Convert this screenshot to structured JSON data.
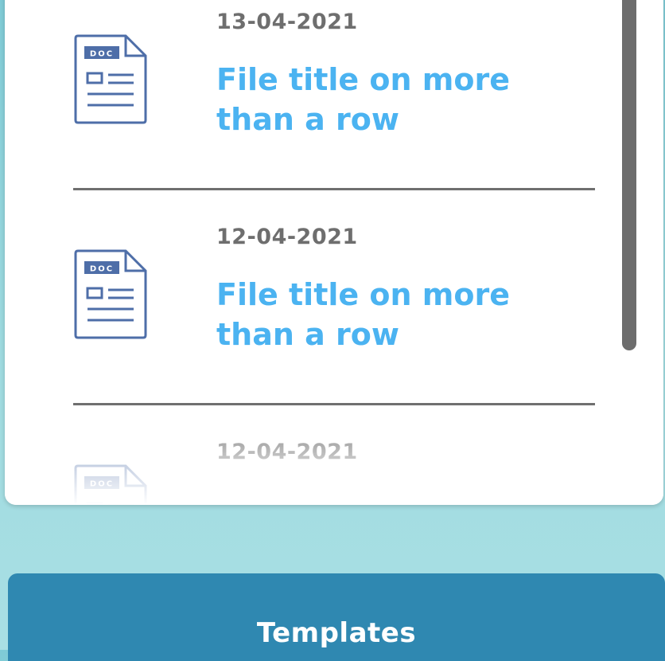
{
  "colors": {
    "title_accent": "#4bb3f1",
    "date_text": "#6e6e6e",
    "icon_stroke": "#4e6ea8",
    "button_bg": "#2f88b1",
    "button_text": "#ffffff"
  },
  "file_list": {
    "items": [
      {
        "icon": "doc-icon",
        "icon_label": "DOC",
        "date": "13-04-2021",
        "title": "File title on more than a row"
      },
      {
        "icon": "doc-icon",
        "icon_label": "DOC",
        "date": "12-04-2021",
        "title": "File title on more than a row"
      },
      {
        "icon": "doc-icon",
        "icon_label": "DOC",
        "date": "12-04-2021",
        "title": ""
      }
    ]
  },
  "footer": {
    "templates_label": "Templates"
  }
}
